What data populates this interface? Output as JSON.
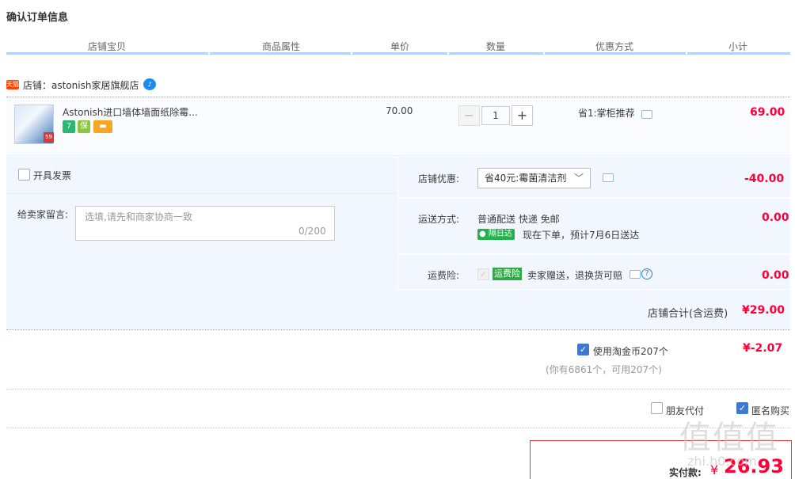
{
  "page_title": "确认订单信息",
  "columns": [
    "店铺宝贝",
    "商品属性",
    "单价",
    "数量",
    "优惠方式",
    "小计"
  ],
  "shop": {
    "tmall_badge": "天猫",
    "name": "店铺：astonish家居旗舰店",
    "wangwang_icon": "chat-bubble-icon"
  },
  "item": {
    "thumb_tag": "59",
    "title": "Astonish进口墙体墙面纸除霉...",
    "badges": [
      {
        "icon": "seven-day-return-icon",
        "text": "7",
        "color": "#2bb673"
      },
      {
        "icon": "guarantee-icon",
        "text": "保",
        "color": "#8cc63f"
      },
      {
        "icon": "card-payment-icon",
        "text": "▬",
        "color": "#f5a623"
      }
    ],
    "price": "70.00",
    "qty_minus": "−",
    "quantity": "1",
    "qty_plus": "+",
    "promo": "省1:掌柜推荐",
    "subtotal": "69.00"
  },
  "invoice": {
    "label": "开具发票"
  },
  "memo": {
    "label": "给卖家留言:",
    "placeholder": "选填,请先和商家协商一致",
    "counter": "0/200"
  },
  "shop_discount": {
    "label": "店铺优惠:",
    "selected": "省40元:霉菌清洁剂",
    "amount": "-40.00"
  },
  "shipping": {
    "label": "运送方式:",
    "method": "普通配送 快递 免邮",
    "badge": "隔日达",
    "note": "现在下单，预计7月6日送达",
    "amount": "0.00"
  },
  "freight_insurance": {
    "label": "运费险:",
    "badge": "运费险",
    "text": "卖家赠送，退换货可赔",
    "amount": "0.00"
  },
  "shop_total": {
    "label": "店铺合计(含运费)",
    "amount": "¥29.00"
  },
  "taojinbi": {
    "label": "使用淘金币207个",
    "sub": "(你有6861个，可用207个)",
    "amount": "¥-2.07"
  },
  "options": {
    "friend_pay": "朋友代付",
    "anonymous": "匿名购买"
  },
  "pay": {
    "label": "实付款:",
    "currency": "¥",
    "amount": "26.93"
  },
  "watermark": {
    "big": "值值值",
    "small": "zhi.h0.com"
  },
  "colors": {
    "accent_blue": "#b2d1ff",
    "price_red": "#ff0036",
    "panel_bg": "#f2f7ff"
  }
}
